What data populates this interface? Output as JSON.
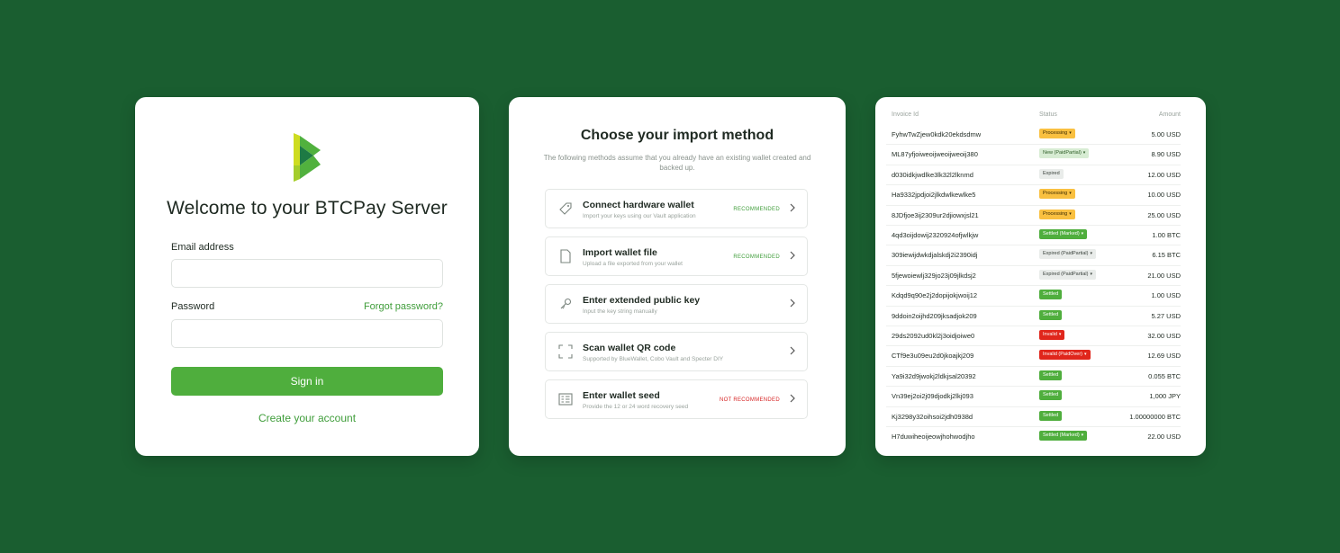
{
  "login": {
    "logo_icon": "btcpay-logo-icon",
    "title": "Welcome to your BTCPay Server",
    "email_label": "Email address",
    "email_value": "",
    "password_label": "Password",
    "password_value": "",
    "forgot_link": "Forgot password?",
    "signin_label": "Sign in",
    "create_link": "Create your account"
  },
  "import": {
    "title": "Choose your import method",
    "subtitle": "The following methods assume that you already have an existing wallet created and backed up.",
    "options": [
      {
        "icon": "tag-icon",
        "title": "Connect hardware wallet",
        "desc": "Import your keys using our Vault application",
        "badge": "RECOMMENDED"
      },
      {
        "icon": "file-icon",
        "title": "Import wallet file",
        "desc": "Upload a file exported from your wallet",
        "badge": "RECOMMENDED"
      },
      {
        "icon": "key-icon",
        "title": "Enter extended public key",
        "desc": "Input the key string manually",
        "badge": ""
      },
      {
        "icon": "qr-scan-icon",
        "title": "Scan wallet QR code",
        "desc": "Supported by BlueWallet, Cobo Vault and Specter DIY",
        "badge": ""
      },
      {
        "icon": "seed-grid-icon",
        "title": "Enter wallet seed",
        "desc": "Provide the 12 or 24 word recovery seed",
        "badge": "NOT RECOMMENDED"
      }
    ]
  },
  "invoices": {
    "headers": {
      "id": "Invoice Id",
      "status": "Status",
      "amount": "Amount"
    },
    "rows": [
      {
        "id": "FyhwTwZjew0kdk20ekdsdmw",
        "status": "Processing",
        "kind": "processing",
        "dropdown": true,
        "amount": "5.00 USD"
      },
      {
        "id": "ML87yfjoiweoijweoijweoij380",
        "status": "New (PaidPartial)",
        "kind": "new",
        "dropdown": true,
        "amount": "8.90 USD"
      },
      {
        "id": "d030idkjwdlke3lk32l2lknmd",
        "status": "Expired",
        "kind": "expired",
        "dropdown": false,
        "amount": "12.00 USD"
      },
      {
        "id": "Ha9332jpdjoi2jlkdwlkewlke5",
        "status": "Processing",
        "kind": "processing",
        "dropdown": true,
        "amount": "10.00 USD"
      },
      {
        "id": "8JDfjoe3ij2309ur2djiowxjsl21",
        "status": "Processing",
        "kind": "processing",
        "dropdown": true,
        "amount": "25.00 USD"
      },
      {
        "id": "4qd3oijdowij2320924ofjwlkjw",
        "status": "Settled (Marked)",
        "kind": "settled",
        "dropdown": true,
        "amount": "1.00 BTC"
      },
      {
        "id": "309iewijdwkdjalskdj2i2390idj",
        "status": "Expired (PaidPartial)",
        "kind": "expired",
        "dropdown": true,
        "amount": "6.15 BTC"
      },
      {
        "id": "5fjewoiewlj329jo23j09jlkdsj2",
        "status": "Expired (PaidPartial)",
        "kind": "expired",
        "dropdown": true,
        "amount": "21.00 USD"
      },
      {
        "id": "Kdqd9q90e2j2dopijokjwoij12",
        "status": "Settled",
        "kind": "settled",
        "dropdown": false,
        "amount": "1.00 USD"
      },
      {
        "id": "9ddoin2oijhd209jksadjok209",
        "status": "Settled",
        "kind": "settled",
        "dropdown": false,
        "amount": "5.27 USD"
      },
      {
        "id": "29ds2092ud0kl2j3oidjoiwe0",
        "status": "Invalid",
        "kind": "invalid",
        "dropdown": true,
        "amount": "32.00 USD"
      },
      {
        "id": "CTf9e3u09eu2d0jkoajkj209",
        "status": "Invalid (PaidOver)",
        "kind": "invalid",
        "dropdown": true,
        "amount": "12.69 USD"
      },
      {
        "id": "Ya9i32d9jwokj2ldkjsal20392",
        "status": "Settled",
        "kind": "settled",
        "dropdown": false,
        "amount": "0.055 BTC"
      },
      {
        "id": "Vn39ej2oi2j09djodkj2lkj093",
        "status": "Settled",
        "kind": "settled",
        "dropdown": false,
        "amount": "1,000  JPY"
      },
      {
        "id": "Kj3298y32oihsoi2jdh0938d",
        "status": "Settled",
        "kind": "settled",
        "dropdown": false,
        "amount": "1.00000000 BTC"
      },
      {
        "id": "H7duwiheoijeowjhohwodjho",
        "status": "Settled (Marked)",
        "kind": "settled",
        "dropdown": true,
        "amount": "22.00 USD"
      }
    ]
  },
  "colors": {
    "background": "#1a5e30",
    "brand_green": "#4fae3d",
    "processing": "#f9c040",
    "invalid": "#e0261c"
  }
}
